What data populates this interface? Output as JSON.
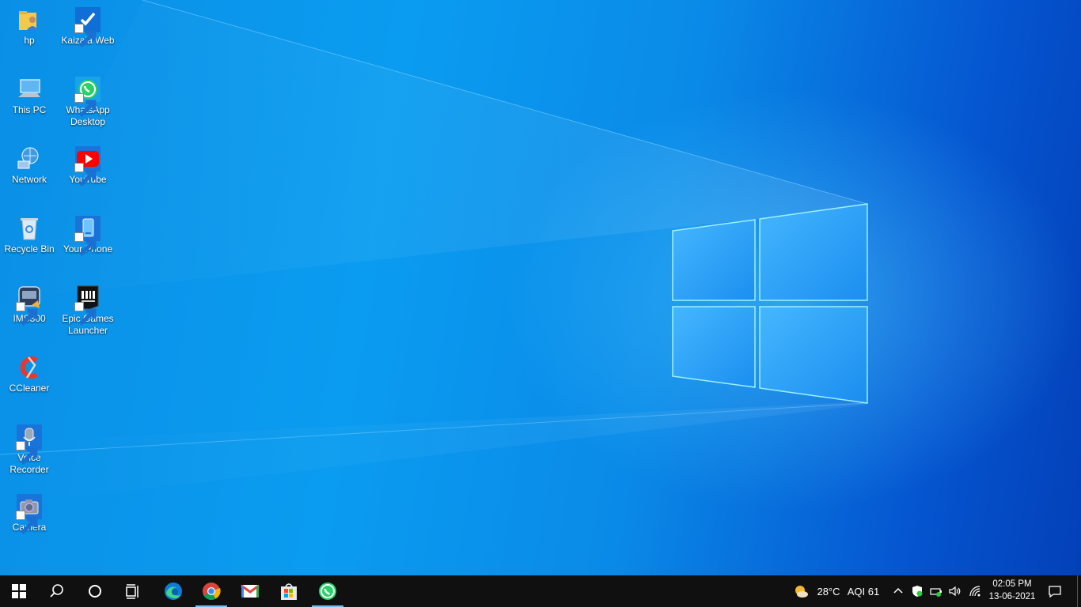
{
  "desktop": {
    "icons": [
      {
        "name": "hp",
        "shortcut": false,
        "icon": "user-folder-icon"
      },
      {
        "name": "Kaizala Web",
        "shortcut": true,
        "icon": "kaizala-icon"
      },
      {
        "name": "This PC",
        "shortcut": false,
        "icon": "computer-icon"
      },
      {
        "name": "WhatsApp Desktop",
        "shortcut": true,
        "icon": "whatsapp-icon"
      },
      {
        "name": "Network",
        "shortcut": false,
        "icon": "network-icon"
      },
      {
        "name": "YouTube",
        "shortcut": true,
        "icon": "youtube-icon"
      },
      {
        "name": "Recycle Bin",
        "shortcut": false,
        "icon": "recycle-bin-icon"
      },
      {
        "name": "Your Phone",
        "shortcut": true,
        "icon": "phone-icon"
      },
      {
        "name": "IMS300",
        "shortcut": true,
        "icon": "ims300-icon"
      },
      {
        "name": "Epic Games Launcher",
        "shortcut": true,
        "icon": "epic-games-icon"
      },
      {
        "name": "CCleaner",
        "shortcut": false,
        "icon": "ccleaner-icon"
      },
      {
        "name": "Voice Recorder",
        "shortcut": true,
        "icon": "microphone-icon"
      },
      {
        "name": "Camera",
        "shortcut": true,
        "icon": "camera-icon"
      }
    ]
  },
  "taskbar": {
    "start": "windows-logo-icon",
    "search": "search-icon",
    "cortana": "cortana-icon",
    "task_view": "task-view-icon",
    "pinned": [
      "edge-icon",
      "chrome-icon",
      "gmail-icon",
      "store-icon",
      "whatsapp-icon"
    ],
    "weather": {
      "temperature": "28°C",
      "aqi": "AQI 61",
      "icon": "sun-cloud-icon"
    },
    "clock": {
      "time": "02:05 PM",
      "date": "13-06-2021"
    },
    "colors": {
      "taskbar": "#101010",
      "active_indicator": "#76b9ed"
    }
  }
}
